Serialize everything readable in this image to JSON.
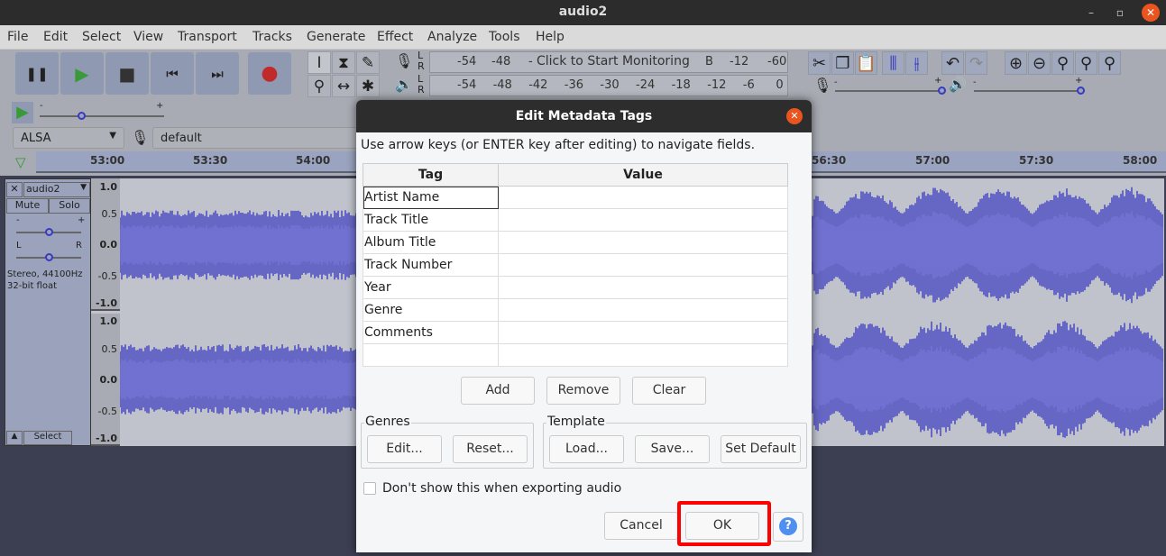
{
  "window": {
    "title": "audio2"
  },
  "menu": [
    "File",
    "Edit",
    "Select",
    "View",
    "Transport",
    "Tracks",
    "Generate",
    "Effect",
    "Analyze",
    "Tools",
    "Help"
  ],
  "transport": [
    {
      "name": "pause",
      "glyph": "❚❚"
    },
    {
      "name": "play",
      "glyph": "▶"
    },
    {
      "name": "stop",
      "glyph": "■"
    },
    {
      "name": "skip-start",
      "glyph": "⏮"
    },
    {
      "name": "skip-end",
      "glyph": "⏭"
    },
    {
      "name": "record",
      "glyph": "●"
    }
  ],
  "tools": [
    {
      "name": "selection",
      "glyph": "I"
    },
    {
      "name": "envelope",
      "glyph": "⧗"
    },
    {
      "name": "draw",
      "glyph": "✎"
    },
    {
      "name": "zoom",
      "glyph": "⚲"
    },
    {
      "name": "time-shift",
      "glyph": "↔"
    },
    {
      "name": "multi",
      "glyph": "✱"
    }
  ],
  "meters": {
    "record_ticks": [
      "-54",
      "-48",
      "-",
      "B",
      "-12",
      "-6",
      "0"
    ],
    "monitor_text": "Click to Start Monitoring",
    "play_ticks": [
      "-54",
      "-48",
      "-42",
      "-36",
      "-30",
      "-24",
      "-18",
      "-12",
      "-6",
      "0"
    ],
    "channels": [
      "L",
      "R"
    ]
  },
  "edit_tools": [
    {
      "name": "cut",
      "glyph": "✂"
    },
    {
      "name": "copy",
      "glyph": "❐"
    },
    {
      "name": "paste",
      "glyph": "📋"
    },
    {
      "name": "trim",
      "glyph": "⫼"
    },
    {
      "name": "silence",
      "glyph": "⫲"
    },
    {
      "name": "undo",
      "glyph": "↶"
    },
    {
      "name": "redo",
      "glyph": "↷"
    },
    {
      "name": "zoom-in",
      "glyph": "⊕"
    },
    {
      "name": "zoom-out",
      "glyph": "⊖"
    },
    {
      "name": "fit-selection",
      "glyph": "⚲"
    },
    {
      "name": "fit-project",
      "glyph": "⚲"
    },
    {
      "name": "zoom-toggle",
      "glyph": "⚲"
    }
  ],
  "mixer": {
    "minus": "-",
    "plus": "+",
    "record_volume": 1.0,
    "playback_volume": 1.0
  },
  "play_at_speed": {
    "minus": "-",
    "plus": "+",
    "speed_fraction": 0.35
  },
  "device": {
    "host": "ALSA",
    "input": "default"
  },
  "timeline": [
    "53:00",
    "53:30",
    "54:00",
    "56:30",
    "57:00",
    "57:30",
    "58:00"
  ],
  "track": {
    "name": "audio2",
    "close": "✕",
    "mute": "Mute",
    "solo": "Solo",
    "minus": "-",
    "plus": "+",
    "pan_l": "L",
    "pan_r": "R",
    "gain_fraction": 0.5,
    "pan_fraction": 0.5,
    "info1": "Stereo, 44100Hz",
    "info2": "32-bit float",
    "select": "Select",
    "scale": [
      "1.0",
      "0.5",
      "0.0",
      "-0.5",
      "-1.0"
    ],
    "wave_color": "#3535c0"
  },
  "dialog": {
    "title": "Edit Metadata Tags",
    "instructions": "Use arrow keys (or ENTER key after editing) to navigate fields.",
    "columns": [
      "Tag",
      "Value"
    ],
    "rows": [
      {
        "tag": "Artist Name",
        "value": ""
      },
      {
        "tag": "Track Title",
        "value": ""
      },
      {
        "tag": "Album Title",
        "value": ""
      },
      {
        "tag": "Track Number",
        "value": ""
      },
      {
        "tag": "Year",
        "value": ""
      },
      {
        "tag": "Genre",
        "value": ""
      },
      {
        "tag": "Comments",
        "value": ""
      },
      {
        "tag": "",
        "value": ""
      }
    ],
    "add": "Add",
    "remove": "Remove",
    "clear": "Clear",
    "genres": {
      "label": "Genres",
      "edit": "Edit...",
      "reset": "Reset..."
    },
    "template": {
      "label": "Template",
      "load": "Load...",
      "save": "Save...",
      "set_default": "Set Default"
    },
    "dont_show": "Don't show this when exporting audio",
    "dont_show_checked": false,
    "cancel": "Cancel",
    "ok": "OK",
    "help": "?"
  },
  "highlight_color": "#ff0000"
}
